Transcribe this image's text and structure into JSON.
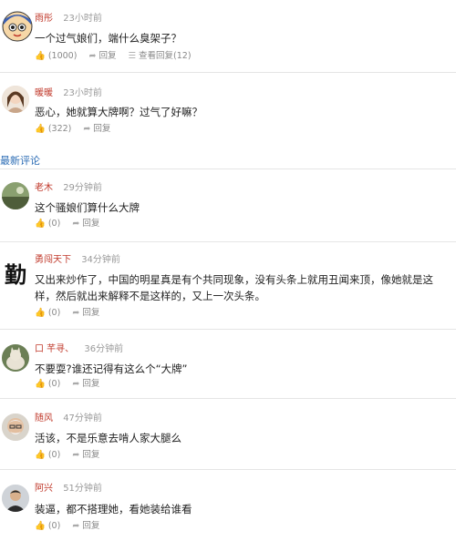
{
  "section_title": "最新评论",
  "labels": {
    "reply": "回复",
    "view_reply": "查看回复"
  },
  "comments": [
    {
      "author": "雨彤",
      "time": "23小时前",
      "text": "一个过气娘们，端什么臭架子？",
      "likes": "(1000)",
      "view_count": "(12)",
      "avatar": "cartoon-girl",
      "author_color": "#c0392b"
    },
    {
      "author": "暖暖",
      "time": "23小时前",
      "text": "恶心，她就算大牌啊？过气了好嘛？",
      "likes": "(322)",
      "avatar": "woman-photo"
    },
    {
      "author": "老木",
      "time": "29分钟前",
      "text": "这个骚娘们算什么大牌",
      "likes": "(0)",
      "avatar": "landscape"
    },
    {
      "author": "勇闯天下",
      "time": "34分钟前",
      "text": "又出来炒作了，中国的明星真是有个共同现象，没有头条上就用丑闻来顶，像她就是这样，然后就出来解释不是这样的，又上一次头条。",
      "likes": "(0)",
      "avatar": "calligraphy"
    },
    {
      "author": "口 芊寻、",
      "time": "36分钟前",
      "text": "不要耍?谁还记得有这么个“大牌”",
      "likes": "(0)",
      "avatar": "cat"
    },
    {
      "author": "随风",
      "time": "47分钟前",
      "text": "活该，不是乐意去啃人家大腿么",
      "likes": "(0)",
      "avatar": "old-man"
    },
    {
      "author": "阿兴",
      "time": "51分钟前",
      "text": "装逼，都不搭理她，看她装给谁看",
      "likes": "(0)",
      "avatar": "man-portrait"
    }
  ]
}
